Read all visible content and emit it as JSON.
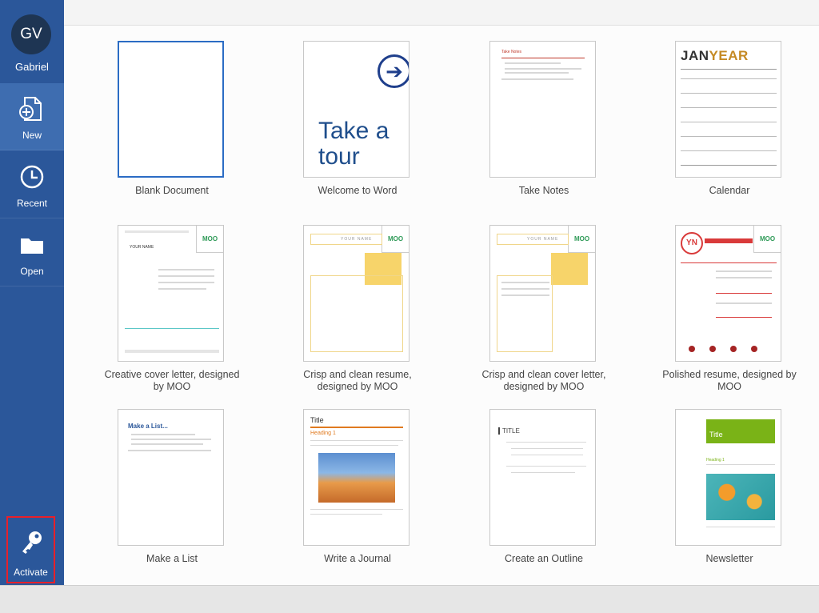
{
  "user": {
    "initials": "GV",
    "name": "Gabriel"
  },
  "nav": {
    "new": "New",
    "recent": "Recent",
    "open": "Open",
    "activate": "Activate"
  },
  "templates": [
    {
      "caption": "Blank Document"
    },
    {
      "caption": "Welcome to Word",
      "thumb_text": "Take a tour"
    },
    {
      "caption": "Take Notes",
      "thumb_text": "Take Notes"
    },
    {
      "caption": "Calendar",
      "thumb_text_a": "JAN",
      "thumb_text_b": "YEAR"
    },
    {
      "caption": "Creative cover letter, designed by MOO",
      "thumb_text": "YOUR NAME",
      "badge": "MOO"
    },
    {
      "caption": "Crisp and clean resume, designed by MOO",
      "thumb_text": "YOUR NAME",
      "badge": "MOO"
    },
    {
      "caption": "Crisp and clean cover letter, designed by MOO",
      "thumb_text": "YOUR NAME",
      "badge": "MOO"
    },
    {
      "caption": "Polished resume, designed by MOO",
      "thumb_text": "YN",
      "badge": "MOO"
    },
    {
      "caption": "Make a List",
      "thumb_text": "Make a List..."
    },
    {
      "caption": "Write a Journal",
      "thumb_text": "Title",
      "thumb_heading": "Heading 1"
    },
    {
      "caption": "Create an Outline",
      "thumb_text": "TITLE"
    },
    {
      "caption": "Newsletter",
      "thumb_text": "Title",
      "thumb_heading": "Heading 1"
    }
  ],
  "colors": {
    "sidebar": "#2b579a",
    "active": "#3e6db0",
    "accent_selected": "#2b6cc4",
    "activate_outline": "#e8202a"
  }
}
